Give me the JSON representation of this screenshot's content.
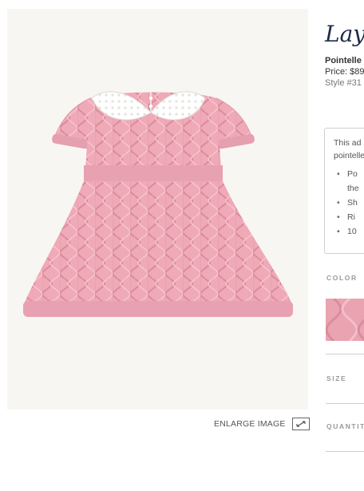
{
  "brand": {
    "logo_text": "Layette"
  },
  "product": {
    "name": "Pointelle",
    "price": "Price: $89",
    "style": "Style #31"
  },
  "description": {
    "text": "This ad\npointelle",
    "bullets": [
      "Po\nthe",
      "Sh",
      "Ri",
      "10"
    ]
  },
  "options": {
    "color_label": "COLOR",
    "size_label": "SIZE",
    "quantity_label": "QUANTIT",
    "swatch_color": "#e9a3b1"
  },
  "image": {
    "enlarge_label": "ENLARGE IMAGE",
    "background": "#f8f6f2",
    "dress_color": "#efa9b7",
    "collar_color": "#ffffff"
  }
}
